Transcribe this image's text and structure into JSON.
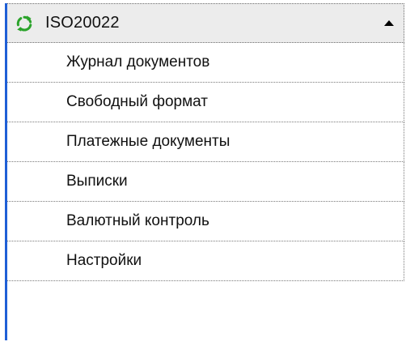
{
  "menu": {
    "header": {
      "icon": "refresh-icon",
      "icon_color": "#2aa32a",
      "title": "ISO20022",
      "arrow_icon": "collapse-arrow-icon"
    },
    "accent_color": "#1f5fd6",
    "items": [
      {
        "label": "Журнал документов"
      },
      {
        "label": "Свободный формат"
      },
      {
        "label": "Платежные документы"
      },
      {
        "label": "Выписки"
      },
      {
        "label": "Валютный контроль"
      },
      {
        "label": "Настройки"
      }
    ]
  }
}
